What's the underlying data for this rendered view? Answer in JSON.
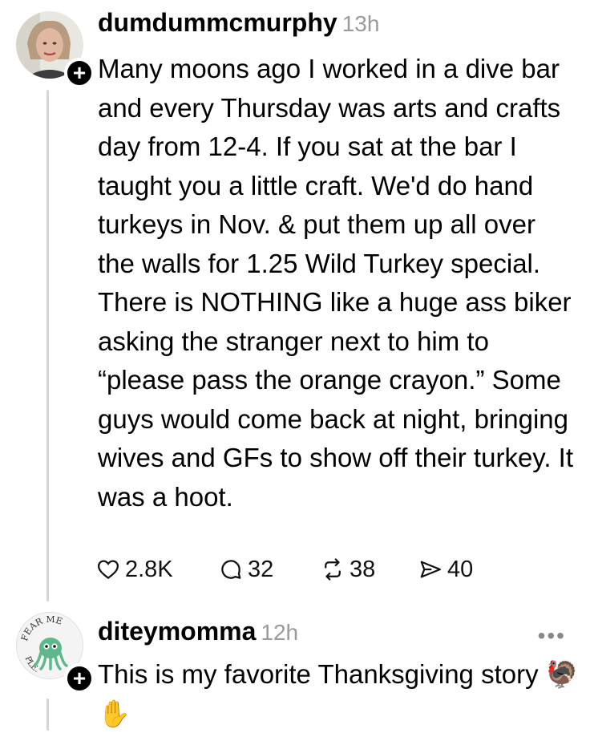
{
  "posts": [
    {
      "username": "dumdummcmurphy",
      "time": "13h",
      "text": "Many moons ago I worked in a dive bar and every Thursday was arts and crafts day from 12-4. If you sat at the bar I taught you a little craft. We'd do hand turkeys in Nov. & put them up all over the walls for 1.25 Wild Turkey special. There is NOTHING like a huge ass biker asking the stranger next to him to “please pass the orange crayon.” Some guys would come back at night, bringing wives and GFs to show off their turkey. It was a hoot.",
      "likes": "2.8K",
      "replies": "32",
      "reposts": "38",
      "shares": "40"
    },
    {
      "username": "diteymomma",
      "time": "12h",
      "text": "This is my favorite Thanksgiving story",
      "emoji": "🦃✋",
      "more": "•••",
      "avatar_text_top": "FEAR ME",
      "avatar_text_bottom": "PLE."
    }
  ],
  "icons": {
    "like": "heart-icon",
    "reply": "comment-icon",
    "repost": "repost-icon",
    "share": "share-icon",
    "follow": "plus-icon"
  },
  "colors": {
    "text": "#000000",
    "muted": "#9a9a9a",
    "thread_line": "#d6d6d6"
  }
}
